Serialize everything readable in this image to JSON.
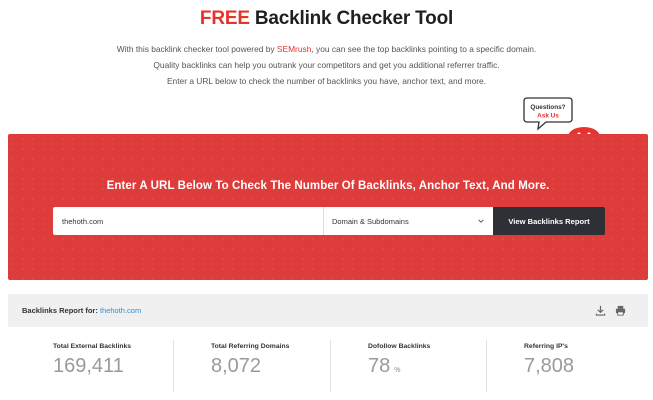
{
  "header": {
    "title_free": "FREE",
    "title_rest": " Backlink Checker Tool",
    "intro_line1_pre": "With this backlink checker tool powered by ",
    "intro_brand": "SEMrush",
    "intro_line1_post": ", you can see the top backlinks pointing to a specific domain.",
    "intro_line2": "Quality backlinks can help you outrank your competitors and get you additional referrer traffic.",
    "intro_line3": "Enter a URL below to check the number of backlinks you have, anchor text, and more."
  },
  "mascot": {
    "bubble_line1": "Questions?",
    "bubble_line2": "Ask Us"
  },
  "hero": {
    "heading": "Enter A URL Below To Check The Number Of Backlinks, Anchor Text, And More.",
    "url_value": "thehoth.com",
    "scope_selected": "Domain & Subdomains",
    "submit_label": "View Backlinks Report"
  },
  "report": {
    "label": "Backlinks Report for: ",
    "domain": "thehoth.com"
  },
  "stats": [
    {
      "label": "Total External Backlinks",
      "value": "169,411",
      "unit": ""
    },
    {
      "label": "Total Referring Domains",
      "value": "8,072",
      "unit": ""
    },
    {
      "label": "Dofollow Backlinks",
      "value": "78",
      "unit": "%"
    },
    {
      "label": "Referring IP's",
      "value": "7,808",
      "unit": ""
    }
  ],
  "colors": {
    "brand_red": "#dd3c3a",
    "accent_red": "#e8322c",
    "button_dark": "#2f3035",
    "link_blue": "#2f8fd8"
  }
}
